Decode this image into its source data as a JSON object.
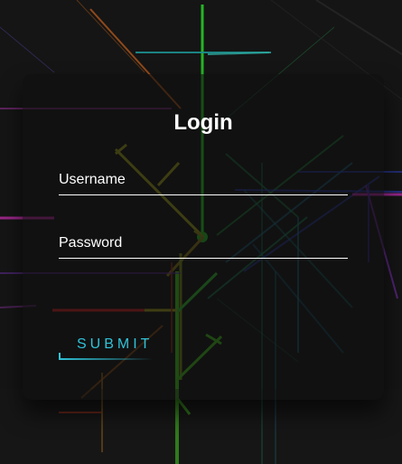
{
  "login": {
    "title": "Login",
    "username_label": "Username",
    "username_value": "",
    "password_label": "Password",
    "password_value": "",
    "submit_label": "SUBMIT"
  },
  "colors": {
    "accent": "#2fc3d8",
    "text": "#ffffff",
    "card_background": "#0e0e0e",
    "page_background": "#151515"
  }
}
